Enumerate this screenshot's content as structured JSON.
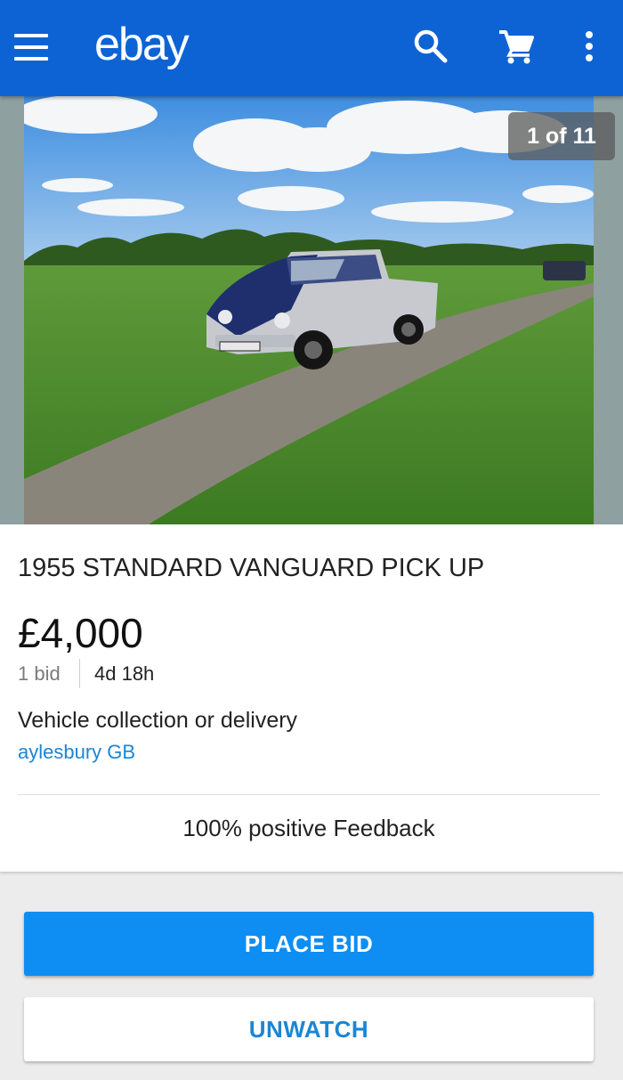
{
  "app": {
    "logo_text": "ebay"
  },
  "appbar": {
    "icons": [
      "menu-icon",
      "search-icon",
      "cart-icon",
      "more-vert-icon"
    ],
    "color": "#0e63d4"
  },
  "gallery": {
    "counter": "1 of 11"
  },
  "listing": {
    "title": "1955 STANDARD VANGUARD PICK UP",
    "price": "£4,000",
    "bids": "1 bid",
    "time_left": "4d 18h",
    "delivery": "Vehicle collection or delivery",
    "location": "aylesbury GB",
    "feedback": "100% positive Feedback"
  },
  "actions": {
    "place_bid": "PLACE BID",
    "unwatch": "UNWATCH"
  },
  "colors": {
    "accent": "#0e8ef3",
    "link": "#1a86d4"
  }
}
